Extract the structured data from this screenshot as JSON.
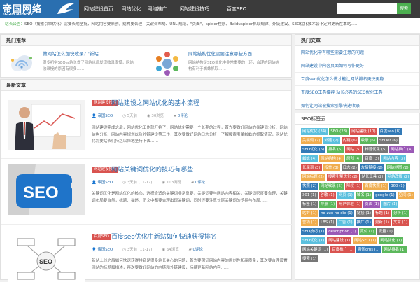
{
  "header": {
    "logo_cn": "帝国网络",
    "logo_en": "D-Guo Network",
    "nav": [
      "网站建设首页",
      "网站优化",
      "网络推广",
      "网站建设技巧",
      "百度SEO"
    ],
    "search_button": "搜索"
  },
  "notice": {
    "label": "站长公告：",
    "text": "SEO（搜索引擎优化）需要长期坚持，网站内容要原创，结构要合理，关键词布局、URL 规范、\"页面\"、spider程序、Baiduspider抓取规律、外链建设、SEO优化技术会不定时更新在本站……"
  },
  "hot": {
    "title": "热门推荐",
    "items": [
      {
        "title": "做网站怎么加快收录？'新站'",
        "desc": "很多初学SEOer站长做了网站以后发现收录很慢，网站收录慢的原因有很多……"
      },
      {
        "title": "网站结构优化需要注意哪些方面",
        "desc": "网站结构是SEO优化中非常重要的一环，合理的网站结构有利于蜘蛛抓取……"
      }
    ]
  },
  "latest": {
    "title": "最新文章",
    "posts": [
      {
        "cat": "网站建设技巧",
        "title": "网站建设之网站优化的基本流程",
        "author": "帝国SEO",
        "date": "5天前",
        "views": "30浏览",
        "comments": "0评论",
        "excerpt": "网站建设完成之后，网站优化工作就开始了，网站优化需要一个长期的过程，首先要做好网站的关键词分析、网站结构分析、网站内容规划以及外链建设等工作，其次要做好网站日志分析，了解搜索引擎蜘蛛的抓取情况，网站优化需要站长们持之以恒地坚持下去……"
      },
      {
        "cat": "网站建设技巧",
        "title": "网站关键词优化的技巧有哪些",
        "author": "帝国SEO",
        "date": "3天前 (11-17)",
        "views": "103浏览",
        "comments": "0评论",
        "excerpt": "关键词优化是网站优化的核心，选择合适的关键词非常重要，关键词要与网站内容相关，关键词密度要合理，关键词布局要自然，标题、描述、正文中都要合理出现关键词，同时还要注意长尾关键词的挖掘与布局……"
      },
      {
        "cat": "百度SEO",
        "title": "百度seo优化中新站如何快速获得排名",
        "author": "帝国SEO",
        "date": "3天前 (11-17)",
        "views": "64浏览",
        "comments": "0评论",
        "excerpt": "新站上线之后如何快速获得排名是很多站长关心的问题，首先要保证网站内容的原创性和高质量，其次要合理设置网站的标题和描述，再次要做好网站的内链和外链建设，持续更新网站内容……"
      }
    ]
  },
  "sidebar": {
    "rec_title": "热门文章",
    "rec_links": [
      "网站优化中有哪些需要注意的问题",
      "网站建设中内容页面如何写作更好",
      "百度seo优化怎么做才能让网站排名更快更稳",
      "百度SEO工具推荐 站长必备的SEO优化工具",
      "如何让网站被搜索引擎快速收录"
    ],
    "tags_title": "SEO标签云",
    "tags": [
      {
        "t": "网站优化 (34)",
        "c": "#5bc0de"
      },
      {
        "t": "SEO (28)",
        "c": "#5cb85c"
      },
      {
        "t": "网站建设 (10)",
        "c": "#d9534f"
      },
      {
        "t": "百度seo (8)",
        "c": "#337ab7"
      },
      {
        "t": "关键词 (7)",
        "c": "#f0ad4e"
      },
      {
        "t": "外链 (7)",
        "c": "#5bc0de"
      },
      {
        "t": "内链 (6)",
        "c": "#d9534f"
      },
      {
        "t": "收录 (6)",
        "c": "#5cb85c"
      },
      {
        "t": "SEOer (6)",
        "c": "#777777"
      },
      {
        "t": "SEO优化 (6)",
        "c": "#337ab7"
      },
      {
        "t": "排名 (5)",
        "c": "#5cb85c"
      },
      {
        "t": "网站 (5)",
        "c": "#d9534f"
      },
      {
        "t": "标题优化 (5)",
        "c": "#777777"
      },
      {
        "t": "网站推广 (4)",
        "c": "#9b59b6"
      },
      {
        "t": "蜘蛛 (4)",
        "c": "#5bc0de"
      },
      {
        "t": "网站结构 (4)",
        "c": "#f0ad4e"
      },
      {
        "t": "原创 (4)",
        "c": "#5cb85c"
      },
      {
        "t": "百度 (3)",
        "c": "#777777"
      },
      {
        "t": "网站内容 (3)",
        "c": "#5bc0de"
      },
      {
        "t": "长尾词 (3)",
        "c": "#d9534f"
      },
      {
        "t": "权重 (3)",
        "c": "#f0ad4e"
      },
      {
        "t": "日志 (2)",
        "c": "#777777"
      },
      {
        "t": "友情链接 (2)",
        "c": "#337ab7"
      },
      {
        "t": "网站地图 (2)",
        "c": "#5cb85c"
      },
      {
        "t": "网站标题 (2)",
        "c": "#f0ad4e"
      },
      {
        "t": "搜索引擎优化 (2)",
        "c": "#d9534f"
      },
      {
        "t": "站长工具 (2)",
        "c": "#777777"
      },
      {
        "t": "网站改版 (2)",
        "c": "#5bc0de"
      },
      {
        "t": "快照 (2)",
        "c": "#337ab7"
      },
      {
        "t": "网站收录 (2)",
        "c": "#5cb85c"
      },
      {
        "t": "降权 (1)",
        "c": "#d9534f"
      },
      {
        "t": "百度快照 (1)",
        "c": "#f0ad4e"
      },
      {
        "t": "360 (1)",
        "c": "#337ab7"
      },
      {
        "t": "301 (1)",
        "c": "#777777"
      },
      {
        "t": "谷歌 (1)",
        "c": "#d9534f"
      },
      {
        "t": "网页 (1)",
        "c": "#5bc0de"
      },
      {
        "t": "域名 (1)",
        "c": "#5cb85c"
      },
      {
        "t": "google (1)",
        "c": "#337ab7"
      },
      {
        "t": "空间 (1)",
        "c": "#f0ad4e"
      },
      {
        "t": "标签 (1)",
        "c": "#777777"
      },
      {
        "t": "导航 (1)",
        "c": "#5cb85c"
      },
      {
        "t": "用户体验 (1)",
        "c": "#d9534f"
      },
      {
        "t": "页面 (1)",
        "c": "#9b59b6"
      },
      {
        "t": "图片 (1)",
        "c": "#5bc0de"
      },
      {
        "t": "站群 (1)",
        "c": "#f0ad4e"
      },
      {
        "t": "no zuo no die (1)",
        "c": "#337ab7"
      },
      {
        "t": "链接 (1)",
        "c": "#777777"
      },
      {
        "t": "标题 (1)",
        "c": "#d9534f"
      },
      {
        "t": "分析 (1)",
        "c": "#5cb85c"
      },
      {
        "t": "营销 (1)",
        "c": "#f0ad4e"
      },
      {
        "t": "LBS (1)",
        "c": "#777777"
      },
      {
        "t": "广告 (1)",
        "c": "#5bc0de"
      },
      {
        "t": "推广 (1)",
        "c": "#337ab7"
      },
      {
        "t": "更新 (1)",
        "c": "#d9534f"
      },
      {
        "t": "文章 (1)",
        "c": "#d9534f"
      },
      {
        "t": "SEO技巧 (1)",
        "c": "#337ab7"
      },
      {
        "t": "description (1)",
        "c": "#9b59b6"
      },
      {
        "t": "竞价 (1)",
        "c": "#5cb85c"
      },
      {
        "t": "流量 (1)",
        "c": "#777777"
      },
      {
        "t": "SEO优化 (1)",
        "c": "#5bc0de"
      },
      {
        "t": "网站建设 (1)",
        "c": "#d9534f"
      },
      {
        "t": "网站SEO (1)",
        "c": "#f0ad4e"
      },
      {
        "t": "网站优化 (1)",
        "c": "#5cb85c"
      },
      {
        "t": "网站关键词 (1)",
        "c": "#777777"
      },
      {
        "t": "百度推广 (1)",
        "c": "#d9534f"
      },
      {
        "t": "帝国cms (1)",
        "c": "#337ab7"
      },
      {
        "t": "网站排名 (1)",
        "c": "#5cb85c"
      },
      {
        "t": "搜索 (1)",
        "c": "#777777"
      }
    ]
  }
}
